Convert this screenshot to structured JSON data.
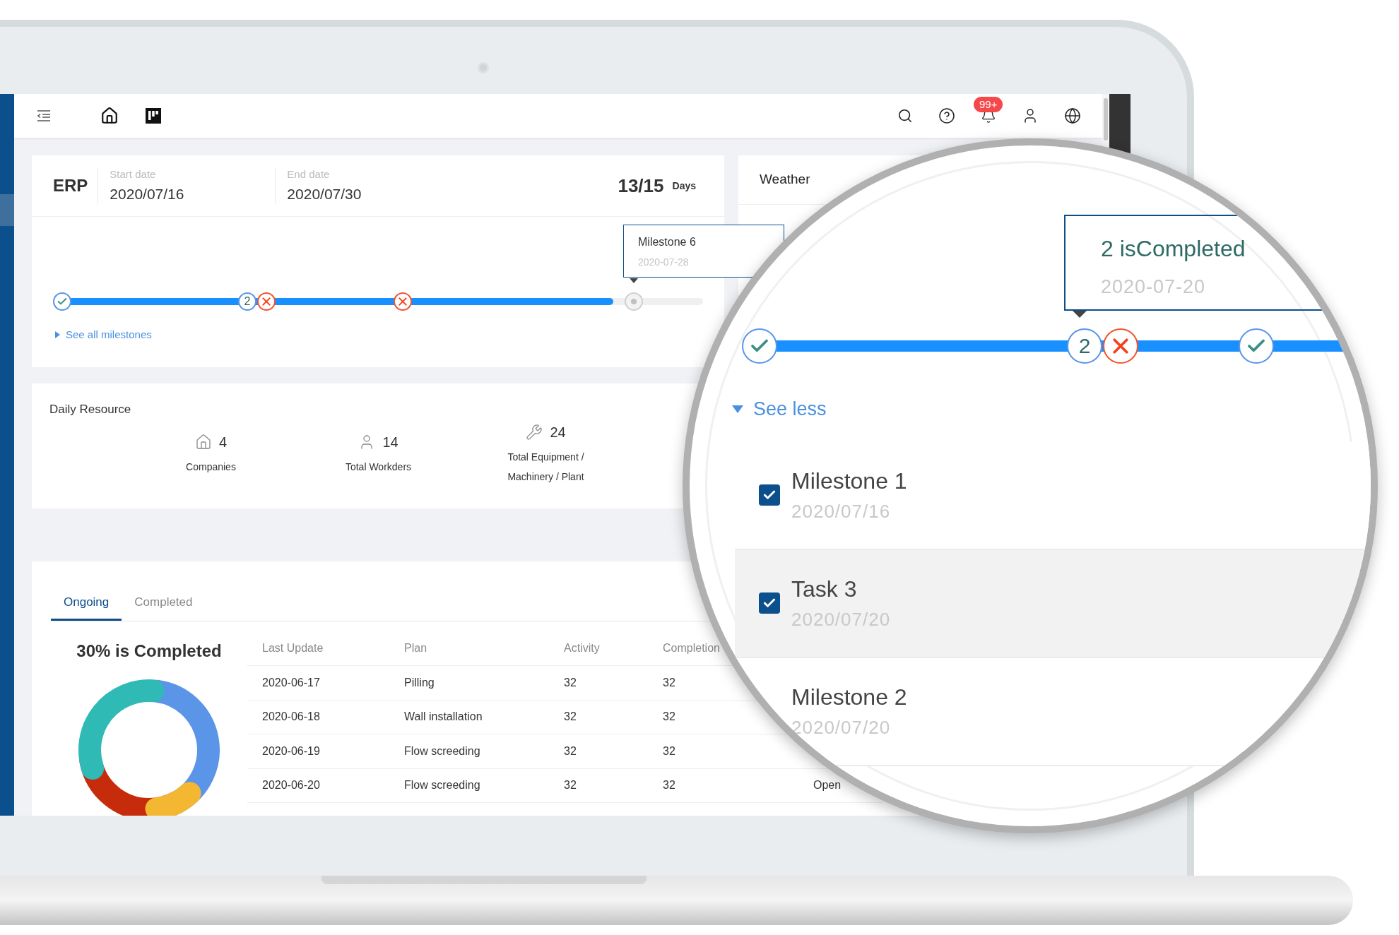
{
  "top_bar": {
    "notifications_badge": "99+"
  },
  "project": {
    "name": "ERP",
    "start_label": "Start date",
    "start_date": "2020/07/16",
    "end_label": "End date",
    "end_date": "2020/07/30",
    "days_count": "13/15",
    "days_unit": "Days"
  },
  "timeline": {
    "level": 0.86,
    "markers": [
      {
        "kind": "done"
      },
      {
        "kind": "count",
        "label": "2"
      },
      {
        "kind": "failed"
      },
      {
        "kind": "failed"
      },
      {
        "kind": "pending"
      }
    ],
    "tooltip": {
      "title": "Milestone 6",
      "date": "2020-07-28"
    },
    "toggle": "See all milestones"
  },
  "weather": {
    "title": "Weather"
  },
  "daily_resource": {
    "title": "Daily Resource",
    "stats": [
      {
        "kind": "company",
        "value": "4",
        "label": "Companies"
      },
      {
        "kind": "worker",
        "value": "14",
        "label": "Total Workders"
      },
      {
        "kind": "equipment",
        "value": "24",
        "label": "Total Equipment / Machinery / Plant"
      }
    ]
  },
  "tasks": {
    "tabs": [
      {
        "label": "Ongoing",
        "selected": true
      },
      {
        "label": "Completed",
        "selected": false
      }
    ],
    "summary": "30% is Completed",
    "table": {
      "columns": [
        "Last Update",
        "Plan",
        "Activity",
        "Completion"
      ],
      "rows": [
        {
          "cells": [
            "2020-06-17",
            "Pilling",
            "32",
            "32"
          ]
        },
        {
          "cells": [
            "2020-06-18",
            "Wall installation",
            "32",
            "32"
          ]
        },
        {
          "cells": [
            "2020-06-19",
            "Flow screeding",
            "32",
            "32"
          ]
        },
        {
          "cells": [
            "2020-06-20",
            "Flow screeding",
            "32",
            "32",
            "Open"
          ]
        }
      ]
    }
  },
  "magnifier": {
    "tooltip": {
      "title": "2 isCompleted",
      "date": "2020-07-20"
    },
    "markers": [
      {
        "kind": "done"
      },
      {
        "kind": "count",
        "label": "2"
      },
      {
        "kind": "failed"
      },
      {
        "kind": "done"
      }
    ],
    "toggle": "See less",
    "items": [
      {
        "name": "Milestone 1",
        "date": "2020/07/16",
        "checked": true,
        "selected": false
      },
      {
        "name": "Task 3",
        "date": "2020/07/20",
        "checked": true,
        "selected": true
      },
      {
        "name": "Milestone 2",
        "date": "2020/07/20",
        "selected": false
      }
    ]
  }
}
